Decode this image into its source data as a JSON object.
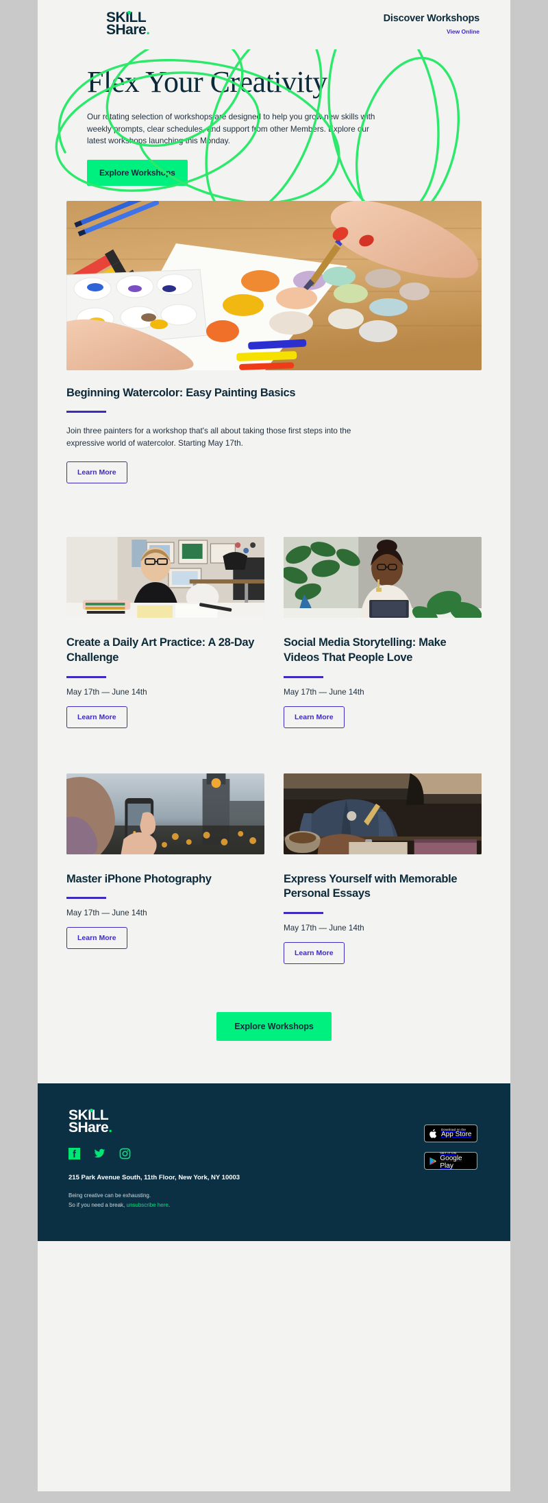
{
  "brand": {
    "logo_line1": "SKILL",
    "logo_line2": "SHare",
    "logo_dot": ".",
    "green": "#00f080",
    "navy": "#0c2a3a",
    "purple": "#3d2bbd",
    "footer_bg": "#0b3043",
    "page_bg": "#f3f3f1"
  },
  "header": {
    "discover_label": "Discover Workshops",
    "view_online_label": "View Online"
  },
  "hero": {
    "title": "Flex Your Creativity",
    "body": "Our rotating selection of workshops are designed to help you grow new skills with weekly prompts, clear schedules, and support from other Members. Explore our latest workshops launching this Monday.",
    "cta_label": "Explore Workshops",
    "image_alt": "hand painting watercolor swatches on paper with palette and paint tubes"
  },
  "feature": {
    "title": "Beginning Watercolor: Easy Painting Basics",
    "body": "Join three painters for a workshop that's all about taking those first steps into the expressive world of watercolor. Starting May 17th.",
    "cta_label": "Learn More"
  },
  "cards": [
    {
      "title": "Create a Daily Art Practice: A 28-Day Challenge",
      "dates": "May 17th — June 14th",
      "cta_label": "Learn More",
      "image_alt": "woman with glasses drawing at a white desk with markers"
    },
    {
      "title": "Social Media Storytelling: Make Videos That People Love",
      "dates": "May 17th — June 14th",
      "cta_label": "Learn More",
      "image_alt": "smiling woman with tablet surrounded by plants"
    },
    {
      "title": "Master iPhone Photography",
      "dates": "May 17th — June 14th",
      "cta_label": "Learn More",
      "image_alt": "person photographing a city skyline at dusk with a phone"
    },
    {
      "title": "Express Yourself with Memorable Personal Essays",
      "dates": "May 17th — June 14th",
      "cta_label": "Learn More",
      "image_alt": "person in denim jacket writing in a notebook beside a coffee cup"
    }
  ],
  "bottom_cta": {
    "label": "Explore Workshops"
  },
  "footer": {
    "socials": [
      "facebook-icon",
      "twitter-icon",
      "instagram-icon"
    ],
    "address": "215 Park Avenue South, 11th Floor, New York, NY 10003",
    "legal_line1": "Being creative can be exhausting.",
    "legal_line2_prefix": "So if you need a break, ",
    "unsubscribe_label": "unsubscribe here",
    "legal_line2_suffix": ".",
    "app_store": {
      "small": "Download on the",
      "big": "App Store"
    },
    "google_play": {
      "small": "GET IT ON",
      "big": "Google Play"
    }
  }
}
